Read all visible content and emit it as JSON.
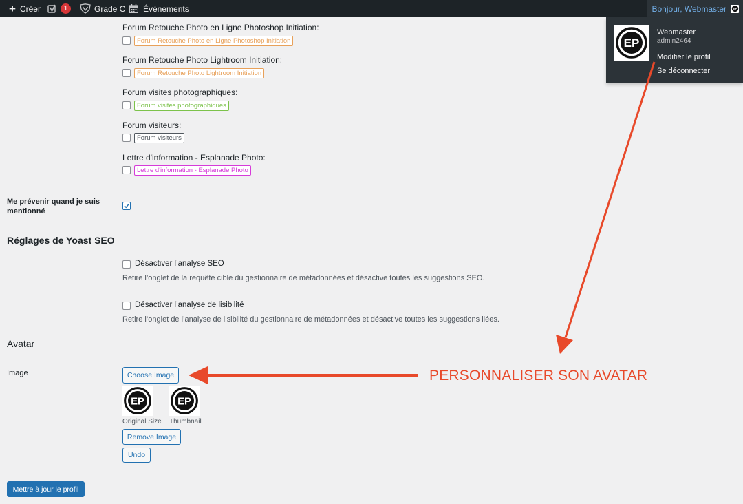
{
  "admin_bar": {
    "create_label": "Créer",
    "notif_count": "1",
    "grade_label": "Grade C",
    "events_label": "Évènements",
    "greeting": "Bonjour, Webmaster"
  },
  "user_menu": {
    "name": "Webmaster",
    "login": "admin2464",
    "edit_profile": "Modifier le profil",
    "logout": "Se déconnecter"
  },
  "forums": [
    {
      "title": "Forum Retouche Photo en Ligne Photoshop Initiation:",
      "tag": "Forum Retouche Photo en Ligne Photoshop Initiation",
      "color": "#e8a15a"
    },
    {
      "title": "Forum Retouche Photo Lightroom Initiation:",
      "tag": "Forum Retouche Photo Lightroom Initiation",
      "color": "#e8a15a"
    },
    {
      "title": "Forum visites photographiques:",
      "tag": "Forum visites photographiques",
      "color": "#7cc24b"
    },
    {
      "title": "Forum visiteurs:",
      "tag": "Forum visiteurs",
      "color": "#50575e"
    },
    {
      "title": "Lettre d'information - Esplanade Photo:",
      "tag": "Lettre d'information - Esplanade Photo",
      "color": "#d63bd9"
    }
  ],
  "mention": {
    "label": "Me prévenir quand je suis mentionné",
    "checked": true
  },
  "yoast": {
    "heading": "Réglages de Yoast SEO",
    "seo_label": "Désactiver l’analyse SEO",
    "seo_desc": "Retire l’onglet de la requête cible du gestionnaire de métadonnées et désactive toutes les suggestions SEO.",
    "read_label": "Désactiver l’analyse de lisibilité",
    "read_desc": "Retire l’onglet de l’analyse de lisibilité du gestionnaire de métadonnées et désactive toutes les suggestions liées."
  },
  "avatar": {
    "heading": "Avatar",
    "image_label": "Image",
    "choose": "Choose Image",
    "original": "Original Size",
    "thumbnail": "Thumbnail",
    "remove": "Remove Image",
    "undo": "Undo",
    "logo_text": "EP"
  },
  "submit": "Mettre à jour le profil",
  "annotation": {
    "text": "PERSONNALISER SON AVATAR",
    "color": "#e8492a"
  }
}
